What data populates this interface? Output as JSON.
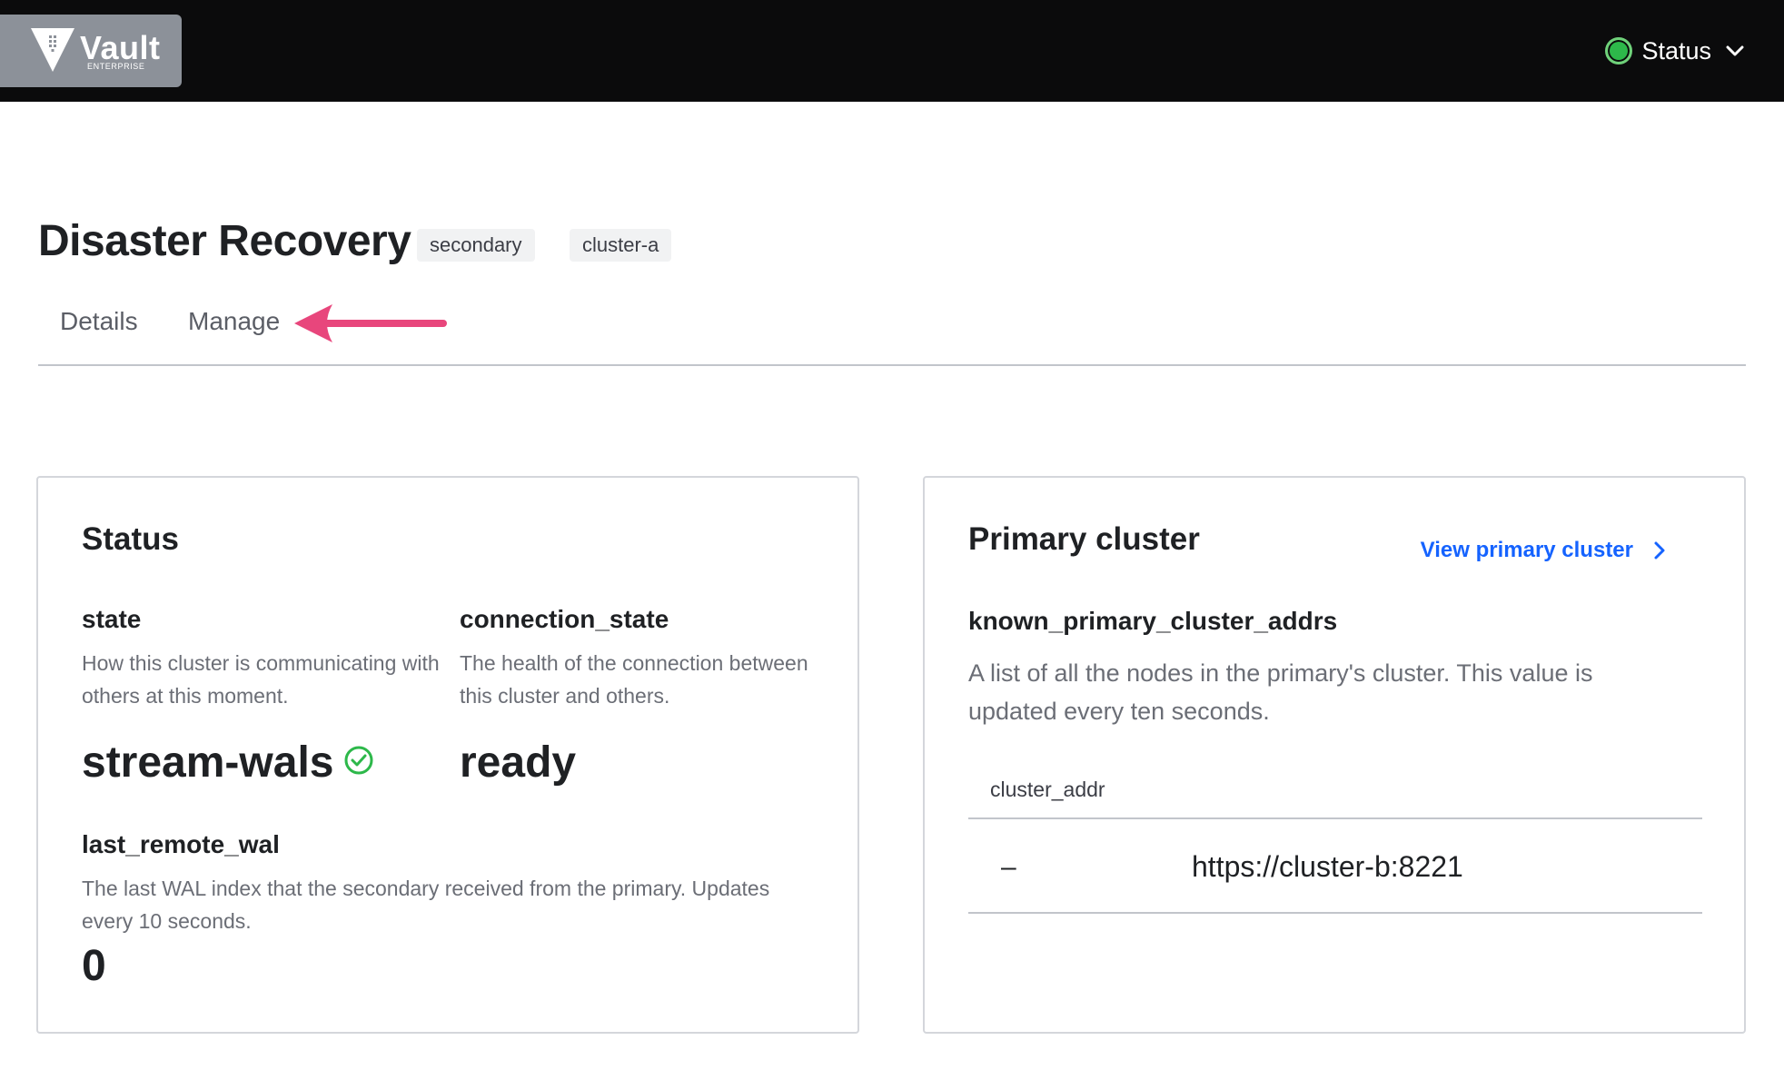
{
  "header": {
    "logo_text": "Vault",
    "logo_sub": "ENTERPRISE",
    "status_label": "Status",
    "status_color": "#2db84a"
  },
  "page": {
    "title": "Disaster Recovery",
    "tags": [
      "secondary",
      "cluster-a"
    ],
    "tabs": [
      {
        "label": "Details"
      },
      {
        "label": "Manage"
      }
    ],
    "annotation_arrow_color": "#e8467c"
  },
  "status_card": {
    "title": "Status",
    "state": {
      "label": "state",
      "help": "How this cluster is communicating with others at this moment.",
      "value": "stream-wals",
      "icon": "check-circle-icon",
      "icon_color": "#2db84a"
    },
    "connection_state": {
      "label": "connection_state",
      "help": "The health of the connection between this cluster and others.",
      "value": "ready"
    },
    "last_remote_wal": {
      "label": "last_remote_wal",
      "help": "The last WAL index that the secondary received from the primary. Updates every 10 seconds.",
      "value": "0"
    }
  },
  "primary_card": {
    "title": "Primary cluster",
    "link_label": "View primary cluster",
    "link_color": "#1563ff",
    "field_label": "known_primary_cluster_addrs",
    "field_help": "A list of all the nodes in the primary's cluster. This value is updated every ten seconds.",
    "table": {
      "column": "cluster_addr",
      "rows": [
        {
          "dash": "–",
          "addr": "https://cluster-b:8221"
        }
      ]
    }
  }
}
